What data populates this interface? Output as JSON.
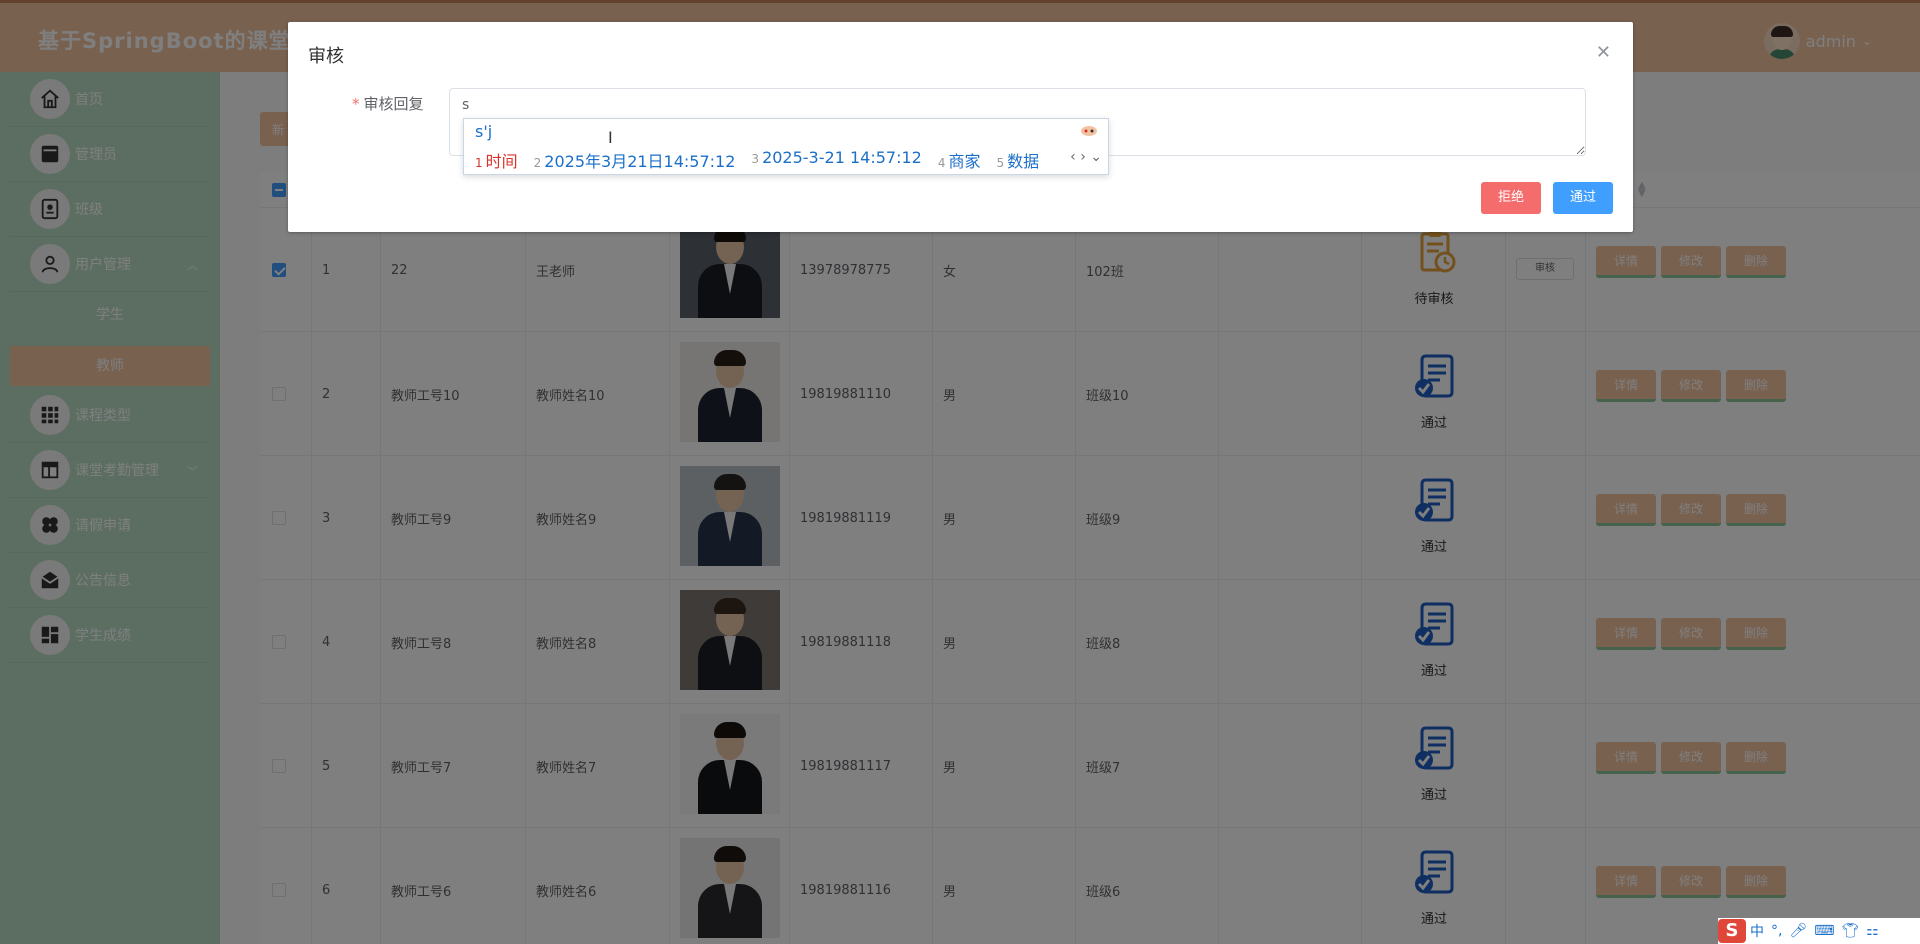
{
  "header": {
    "title": "基于SpringBoot的课堂考",
    "username": "admin"
  },
  "sidebar": {
    "items": [
      {
        "label": "首页",
        "icon": "home-icon"
      },
      {
        "label": "管理员",
        "icon": "monitor-icon"
      },
      {
        "label": "班级",
        "icon": "id-card-icon"
      },
      {
        "label": "用户管理",
        "icon": "user-icon",
        "expanded": true
      },
      {
        "label": "课程类型",
        "icon": "grid-icon"
      },
      {
        "label": "课堂考勤管理",
        "icon": "layout-icon"
      },
      {
        "label": "请假申请",
        "icon": "clover-icon"
      },
      {
        "label": "公告信息",
        "icon": "mail-icon"
      },
      {
        "label": "学生成绩",
        "icon": "dashboard-icon"
      }
    ],
    "sub_items": [
      {
        "label": "学生",
        "active": false
      },
      {
        "label": "教师",
        "active": true
      }
    ]
  },
  "main": {
    "add_button": "新",
    "rows": [
      {
        "index": "1",
        "teacher_no": "22",
        "name": "王老师",
        "phone": "13978978775",
        "gender": "女",
        "class": "102班",
        "status": "待审核",
        "status_kind": "pending",
        "audit_label": "审核",
        "checked": true,
        "photo_bg": "#5a6068",
        "photo_suit": "#1a1d22",
        "photo_hair": "#1b1410"
      },
      {
        "index": "2",
        "teacher_no": "教师工号10",
        "name": "教师姓名10",
        "phone": "19819881110",
        "gender": "男",
        "class": "班级10",
        "status": "通过",
        "status_kind": "approved",
        "checked": false,
        "photo_bg": "#eceae7",
        "photo_suit": "#1c2230",
        "photo_hair": "#2a1f18"
      },
      {
        "index": "3",
        "teacher_no": "教师工号9",
        "name": "教师姓名9",
        "phone": "19819881119",
        "gender": "男",
        "class": "班级9",
        "status": "通过",
        "status_kind": "approved",
        "checked": false,
        "photo_bg": "#b8c0c4",
        "photo_suit": "#27344a",
        "photo_hair": "#2b2622"
      },
      {
        "index": "4",
        "teacher_no": "教师工号8",
        "name": "教师姓名8",
        "phone": "19819881118",
        "gender": "男",
        "class": "班级8",
        "status": "通过",
        "status_kind": "approved",
        "checked": false,
        "photo_bg": "#7d7770",
        "photo_suit": "#1d1f24",
        "photo_hair": "#3a2a20"
      },
      {
        "index": "5",
        "teacher_no": "教师工号7",
        "name": "教师姓名7",
        "phone": "19819881117",
        "gender": "男",
        "class": "班级7",
        "status": "通过",
        "status_kind": "approved",
        "checked": false,
        "photo_bg": "#f4f4f4",
        "photo_suit": "#15171b",
        "photo_hair": "#1c1511"
      },
      {
        "index": "6",
        "teacher_no": "教师工号6",
        "name": "教师姓名6",
        "phone": "19819881116",
        "gender": "男",
        "class": "班级6",
        "status": "通过",
        "status_kind": "approved",
        "checked": false,
        "photo_bg": "#e9e9e9",
        "photo_suit": "#2a2b2e",
        "photo_hair": "#1f1812"
      }
    ],
    "actions": {
      "detail": "详情",
      "edit": "修改",
      "delete": "删除"
    }
  },
  "dialog": {
    "title": "审核",
    "field_label": "审核回复",
    "field_value": "s",
    "reject_label": "拒绝",
    "pass_label": "通过"
  },
  "ime": {
    "composition": "s'j",
    "candidates": [
      {
        "n": "1",
        "text": "时间"
      },
      {
        "n": "2",
        "text": "2025年3月21日14:57:12"
      },
      {
        "n": "3",
        "text": "2025-3-21 14:57:12"
      },
      {
        "n": "4",
        "text": "商家"
      },
      {
        "n": "5",
        "text": "数据"
      }
    ]
  },
  "tray": {
    "logo": "S",
    "lang": "中"
  },
  "colors": {
    "primary": "#409eff",
    "danger": "#f56c6c",
    "accent": "#f2c2a1",
    "sidebar": "#b7dcc3",
    "pending": "#e6a23c",
    "approved": "#1f5fc4"
  }
}
